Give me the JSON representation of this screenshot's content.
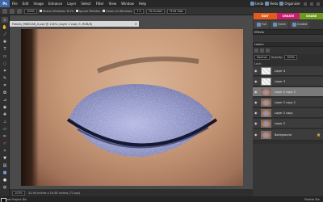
{
  "menubar": {
    "logo": "Ps",
    "items": [
      "File",
      "Edit",
      "Image",
      "Enhance",
      "Layer",
      "Select",
      "Filter",
      "View",
      "Window",
      "Help"
    ],
    "undo_label": "Undo",
    "redo_label": "Redo",
    "organizer_label": "Organizer"
  },
  "options": {
    "zoom_value": "100%",
    "resize_windows_label": "Resize Windows To Fit",
    "ignore_palettes_label": "Ignore Palettes",
    "zoom_all_label": "Zoom All Windows",
    "actual_pixels_label": "1:1",
    "fit_screen_label": "Fit Screen",
    "print_size_label": "Print Size"
  },
  "mode_tabs": [
    "EDIT",
    "CREATE",
    "SHARE"
  ],
  "document": {
    "tab_title": "Fotolia_9660188_X.psd @ 100% (Layer 2 copy 3, RGB/8)",
    "status_zoom": "100%",
    "status_text": "12.94 inches x 10.65 inches (72 ppi)"
  },
  "panels": {
    "strip_full": "Full",
    "strip_quick": "Quick",
    "strip_guided": "Guided",
    "effects_title": "Effects",
    "layers_title": "Layers",
    "blend_mode": "Normal",
    "opacity_label": "Opacity:",
    "opacity_value": "100%",
    "lock_label": "Lock:",
    "layers": [
      {
        "name": "Layer 4",
        "thumb": "mask",
        "selected": false
      },
      {
        "name": "Layer 3",
        "thumb": "mask",
        "selected": false
      },
      {
        "name": "Layer 2 copy 3",
        "thumb": "photo",
        "selected": true
      },
      {
        "name": "Layer 2 copy 2",
        "thumb": "photo",
        "selected": false
      },
      {
        "name": "Layer 2 copy",
        "thumb": "photo",
        "selected": false
      },
      {
        "name": "Layer 2",
        "thumb": "photo",
        "selected": false
      },
      {
        "name": "Background",
        "thumb": "photo",
        "selected": false
      }
    ]
  },
  "bottombar": {
    "left_label": "Show Project Bin",
    "right_label": "Palette Bin"
  },
  "colors": {
    "edit_tab": "#e25a1c",
    "create_tab": "#c61f6a",
    "share_tab": "#6d9a1e",
    "eyeshadow": "#8b90c4"
  }
}
